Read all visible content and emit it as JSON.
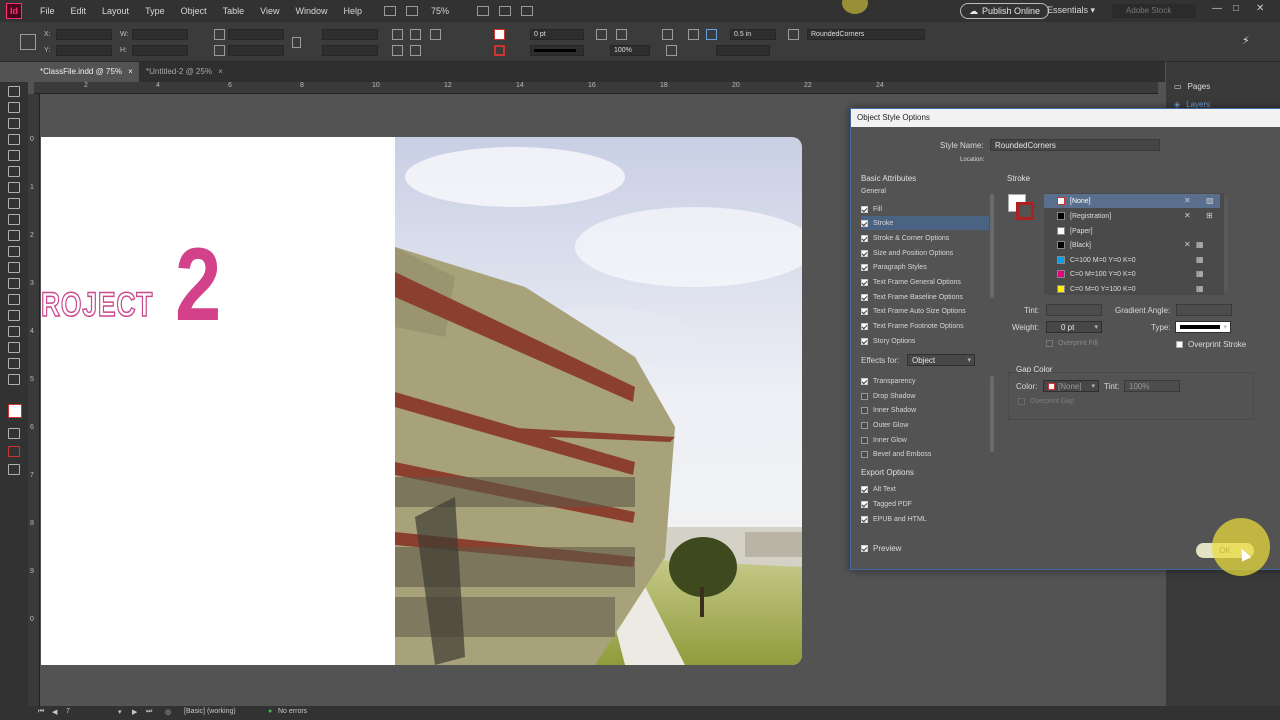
{
  "menu": {
    "app_logo": "Id",
    "items": [
      "File",
      "Edit",
      "Layout",
      "Type",
      "Object",
      "Table",
      "View",
      "Window",
      "Help"
    ],
    "zoom": "75%",
    "publish_online": "Publish Online",
    "workspace": "Essentials",
    "stock_placeholder": "Adobe Stock"
  },
  "control": {
    "x_label": "X:",
    "y_label": "Y:",
    "w_label": "W:",
    "h_label": "H:",
    "stroke_weight": "0 pt",
    "scale": "100%",
    "gap_value": "0.5 in",
    "style_name_field": "RoundedCorners"
  },
  "tabs": [
    {
      "label": "*ClassFile.indd @ 75%",
      "close": "×"
    },
    {
      "label": "*Untitled-2 @ 25%",
      "close": "×"
    }
  ],
  "ruler_h": [
    "2",
    "4",
    "6",
    "8",
    "10",
    "12",
    "14",
    "16",
    "18",
    "20",
    "22",
    "24"
  ],
  "ruler_v": [
    "0",
    "1",
    "2",
    "3",
    "4",
    "5",
    "6",
    "7",
    "8",
    "9",
    "0"
  ],
  "canvas": {
    "project_text": "ROJECT",
    "project_number": "2"
  },
  "panels": {
    "pages": "Pages",
    "layers": "Layers"
  },
  "dialog": {
    "title": "Object Style Options",
    "style_name_label": "Style Name:",
    "style_name_value": "RoundedCorners",
    "location_label": "Location:",
    "basic_attributes": "Basic Attributes",
    "general": "General",
    "basic_items": [
      {
        "label": "Fill",
        "checked": true
      },
      {
        "label": "Stroke",
        "checked": true,
        "selected": true
      },
      {
        "label": "Stroke & Corner Options",
        "checked": true
      },
      {
        "label": "Size and Position Options",
        "checked": true
      },
      {
        "label": "Paragraph Styles",
        "checked": true
      },
      {
        "label": "Text Frame General Options",
        "checked": true
      },
      {
        "label": "Text Frame Baseline Options",
        "checked": true
      },
      {
        "label": "Text Frame Auto Size Options",
        "checked": true
      },
      {
        "label": "Text Frame Footnote Options",
        "checked": true
      },
      {
        "label": "Story Options",
        "checked": true
      }
    ],
    "effects_for_label": "Effects for:",
    "effects_for_value": "Object",
    "effects_items": [
      {
        "label": "Transparency",
        "checked": true
      },
      {
        "label": "Drop Shadow",
        "checked": false
      },
      {
        "label": "Inner Shadow",
        "checked": false
      },
      {
        "label": "Outer Glow",
        "checked": false
      },
      {
        "label": "Inner Glow",
        "checked": false
      },
      {
        "label": "Bevel and Emboss",
        "checked": false
      }
    ],
    "export_options": "Export Options",
    "export_items": [
      {
        "label": "Alt Text",
        "checked": true
      },
      {
        "label": "Tagged PDF",
        "checked": true
      },
      {
        "label": "EPUB and HTML",
        "checked": true
      }
    ],
    "stroke_section": "Stroke",
    "swatches": [
      {
        "name": "[None]",
        "color": "#ffffff",
        "selected": true
      },
      {
        "name": "[Registration]",
        "color": "#000000"
      },
      {
        "name": "[Paper]",
        "color": "#ffffff"
      },
      {
        "name": "[Black]",
        "color": "#000000"
      },
      {
        "name": "C=100 M=0 Y=0 K=0",
        "color": "#00a0e9"
      },
      {
        "name": "C=0 M=100 Y=0 K=0",
        "color": "#e4007f"
      },
      {
        "name": "C=0 M=0 Y=100 K=0",
        "color": "#fff100"
      }
    ],
    "tint_label": "Tint:",
    "gradient_angle_label": "Gradient Angle:",
    "weight_label": "Weight:",
    "weight_value": "0 pt",
    "type_label": "Type:",
    "overprint_fill": "Overprint Fill",
    "overprint_stroke": "Overprint Stroke",
    "gap_color_section": "Gap Color",
    "gap_color_label": "Color:",
    "gap_color_value": "[None]",
    "gap_tint_label": "Tint:",
    "gap_tint_value": "100%",
    "overprint_gap": "Overprint Gap",
    "preview_label": "Preview",
    "ok_label": "OK"
  },
  "status": {
    "page": "7",
    "style": "[Basic] (working)",
    "errors": "No errors"
  }
}
